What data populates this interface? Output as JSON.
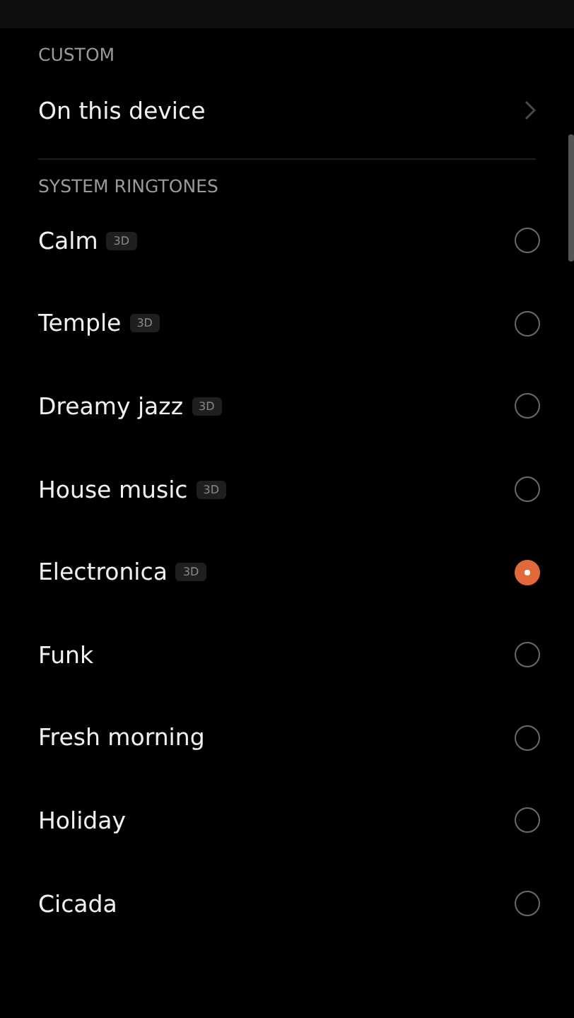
{
  "custom": {
    "heading": "CUSTOM",
    "item": {
      "label": "On this device"
    }
  },
  "system": {
    "heading": "SYSTEM RINGTONES",
    "items": [
      {
        "name": "Calm",
        "badge": "3D",
        "selected": false
      },
      {
        "name": "Temple",
        "badge": "3D",
        "selected": false
      },
      {
        "name": "Dreamy jazz",
        "badge": "3D",
        "selected": false
      },
      {
        "name": "House music",
        "badge": "3D",
        "selected": false
      },
      {
        "name": "Electronica",
        "badge": "3D",
        "selected": true
      },
      {
        "name": "Funk",
        "selected": false
      },
      {
        "name": "Fresh morning",
        "selected": false
      },
      {
        "name": "Holiday",
        "selected": false
      },
      {
        "name": "Cicada",
        "selected": false
      }
    ]
  }
}
